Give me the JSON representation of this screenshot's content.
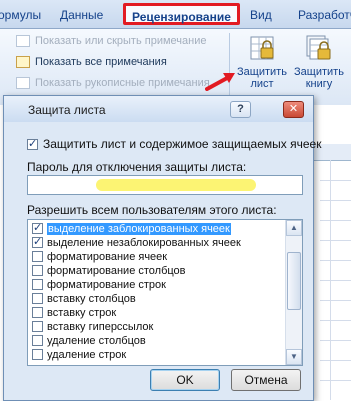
{
  "ribbon": {
    "tabs": [
      {
        "label": "ормулы"
      },
      {
        "label": "Данные"
      },
      {
        "label": "Рецензирование",
        "active": true
      },
      {
        "label": "Вид"
      },
      {
        "label": "Разработч"
      }
    ],
    "comments_group": {
      "show_hide_comment": "Показать или скрыть примечание",
      "show_all_comments": "Показать все примечания",
      "show_ink_comments": "Показать рукописные примечания"
    },
    "protect_sheet_button": {
      "line1": "Защитить",
      "line2": "лист"
    },
    "protect_workbook_button": {
      "line1": "Защитить",
      "line2": "книгу"
    }
  },
  "dialog": {
    "title": "Защита листа",
    "help_label": "?",
    "close_label": "✕",
    "protect_checkbox": {
      "label": "Защитить лист и содержимое защищаемых ячеек",
      "checked": true
    },
    "password_label": "Пароль для отключения защиты листа:",
    "password_value": "",
    "allow_label": "Разрешить всем пользователям этого листа:",
    "permissions": [
      {
        "label": "выделение заблокированных ячеек",
        "checked": true,
        "selected": true
      },
      {
        "label": "выделение незаблокированных ячеек",
        "checked": true,
        "selected": false
      },
      {
        "label": "форматирование ячеек",
        "checked": false,
        "selected": false
      },
      {
        "label": "форматирование столбцов",
        "checked": false,
        "selected": false
      },
      {
        "label": "форматирование строк",
        "checked": false,
        "selected": false
      },
      {
        "label": "вставку столбцов",
        "checked": false,
        "selected": false
      },
      {
        "label": "вставку строк",
        "checked": false,
        "selected": false
      },
      {
        "label": "вставку гиперссылок",
        "checked": false,
        "selected": false
      },
      {
        "label": "удаление столбцов",
        "checked": false,
        "selected": false
      },
      {
        "label": "удаление строк",
        "checked": false,
        "selected": false
      }
    ],
    "ok_label": "OK",
    "cancel_label": "Отмена"
  },
  "colors": {
    "highlight_border": "#e21b23",
    "selection": "#3399ff",
    "password_highlight": "#fbf25a",
    "arrow": "#e21b23"
  }
}
